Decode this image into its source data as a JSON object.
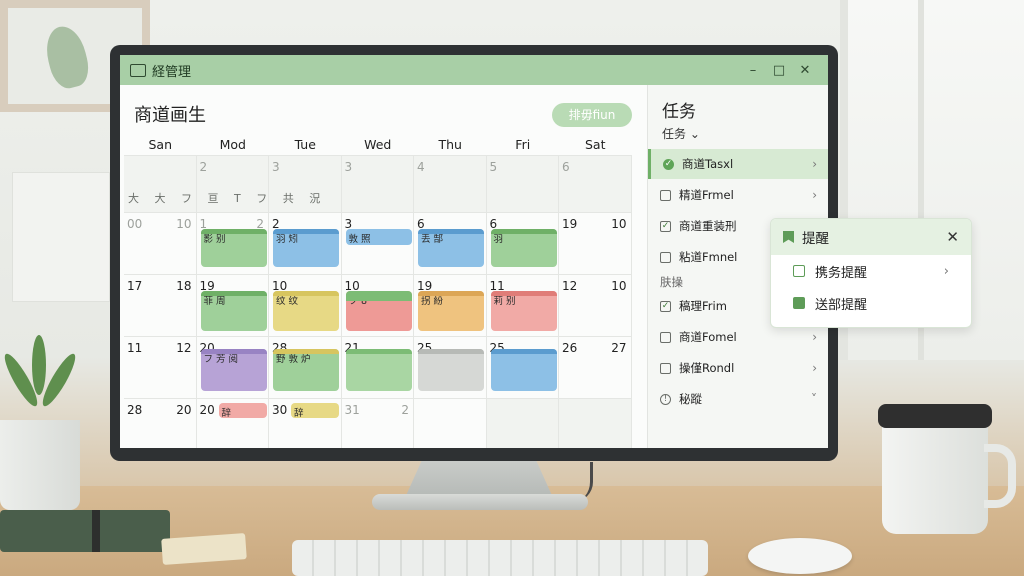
{
  "window": {
    "title": "経管理"
  },
  "calendar": {
    "title": "商道画生",
    "view_button": "排毋fiun",
    "weekdays": [
      "San",
      "Mod",
      "Tue",
      "Wed",
      "Thu",
      "Fri",
      "Sat"
    ],
    "row1": {
      "d1": "2",
      "d2": "3",
      "d3": "3",
      "d4": "4",
      "d5": "5",
      "d6": "6",
      "glyphs": "大 大  フ 亘 T フ 共 況"
    },
    "row2": {
      "c0a": "00",
      "c0b": "10",
      "c1a": "1",
      "c1b": "2",
      "c2": "2",
      "c3": "3",
      "c4": "6",
      "c5": "6",
      "c6a": "19",
      "c6b": "10"
    },
    "row3": {
      "c0a": "17",
      "c0b": "18",
      "c1": "19",
      "c2": "10",
      "c3": "10",
      "c4": "19",
      "c5": "11",
      "c6a": "12",
      "c6b": "10"
    },
    "row4": {
      "c0a": "11",
      "c0b": "12",
      "c1": "20",
      "c2": "28",
      "c3": "21",
      "c4": "25",
      "c5": "25",
      "c6a": "26",
      "c6b": "27"
    },
    "row5": {
      "c0a": "28",
      "c0b": "20",
      "c1": "20",
      "c2": "30",
      "c3a": "31",
      "c3b": "2"
    },
    "events": {
      "r2c1": "影 别",
      "r2c2": "羽 矧",
      "r2c3": "敦 照",
      "r2c4": "丢 郜",
      "r2c5": "羽",
      "r3c1": "菲 周",
      "r3c2": "纹 纹",
      "r3c3": "フ 8",
      "r3c4": "拐 紛",
      "r3c5": "莉 别",
      "r4c1": "フ 芳 阅",
      "r4c2": "野 敦 炉",
      "r5c1": "辞",
      "r5c2": "辞"
    }
  },
  "tasks": {
    "title": "任务",
    "subtitle": "任务 ⌄",
    "items": [
      {
        "label": "商道Tasxl",
        "active": true
      },
      {
        "label": "精道Frmel"
      },
      {
        "label": "商道重装刑"
      },
      {
        "label": "粘道Fmnel"
      },
      {
        "label": "肤操 ..."
      },
      {
        "label": "稿理Frim"
      },
      {
        "label": "商道Fomel"
      },
      {
        "label": "操僅Rondl"
      },
      {
        "label": "秘蹤"
      }
    ],
    "section_label": "肤操"
  },
  "reminder_popup": {
    "title": "提醒",
    "items": [
      {
        "label": "携务提醒"
      },
      {
        "label": "送部提醒"
      }
    ]
  },
  "colors": {
    "titlebar": "#a8cfa6",
    "green": "#8fc98a",
    "blue": "#7fb5dd",
    "yellow": "#e7d985",
    "red": "#ee9a96",
    "orange": "#efc37f",
    "purple": "#b7a3d6",
    "gray": "#cfd1ce"
  }
}
